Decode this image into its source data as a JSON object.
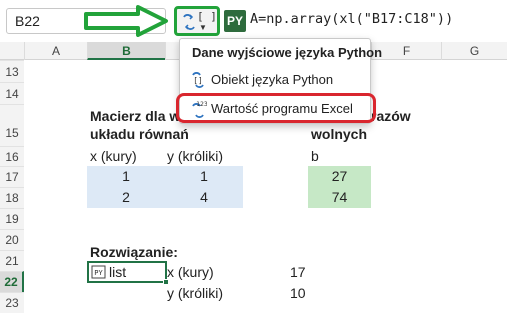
{
  "formula_bar": {
    "name_box": "B22",
    "python_type_label": "[ ]",
    "py_badge": "PY",
    "formula": "A=np.array(xl(\"B17:C18\"))"
  },
  "columns": [
    "A",
    "B",
    "C",
    "D",
    "E",
    "F",
    "G"
  ],
  "selected_column": "B",
  "rows": [
    "13",
    "14",
    "15",
    "16",
    "17",
    "18",
    "19",
    "20",
    "21",
    "22",
    "23"
  ],
  "selected_row": "22",
  "sheet": {
    "heading_line1": "Macierz dla w",
    "heading_line1_right": "razów",
    "heading_line2": "układu równań",
    "heading_line2_right": "wolnych",
    "col_x_label": "x (kury)",
    "col_y_label": "y (króliki)",
    "col_b_label": "b",
    "matrix": [
      {
        "x": "1",
        "y": "1",
        "b": "27"
      },
      {
        "x": "2",
        "y": "4",
        "b": "74"
      }
    ],
    "solution_label": "Rozwiązanie:",
    "result_cell": "list",
    "result_rows": [
      {
        "label": "x (kury)",
        "value": "17"
      },
      {
        "label": "y (króliki)",
        "value": "10"
      }
    ]
  },
  "dropdown": {
    "title": "Dane wyjściowe języka Python",
    "items": [
      {
        "label": "Obiekt języka Python",
        "icon": "python-object-icon"
      },
      {
        "label": "Wartość programu Excel",
        "icon": "excel-value-icon"
      }
    ]
  },
  "colors": {
    "annotation_green": "#22a33a",
    "annotation_red": "#d9262e",
    "matrix_fill": "#dde9f6",
    "vector_fill": "#c6e8c6",
    "excel_green": "#217346"
  }
}
